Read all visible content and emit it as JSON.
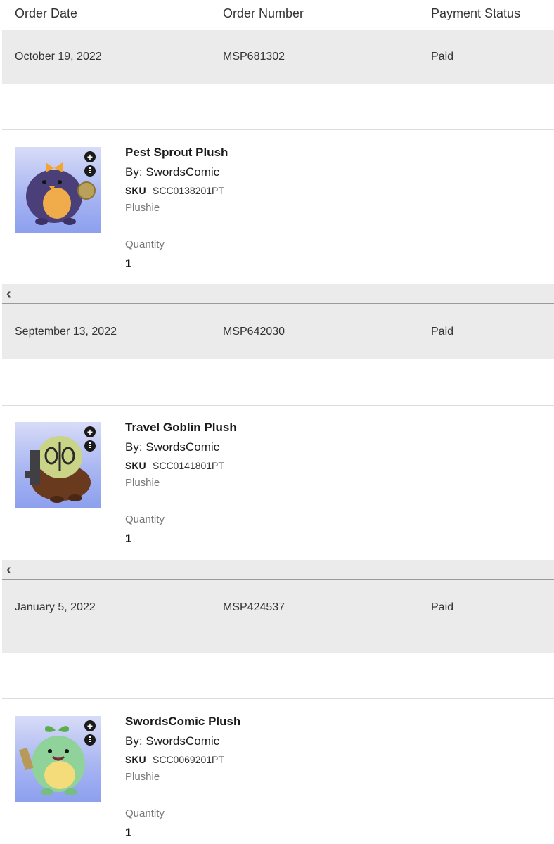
{
  "headers": {
    "order_date": "Order Date",
    "order_number": "Order Number",
    "payment_status": "Payment Status"
  },
  "orders": [
    {
      "date": "October 19, 2022",
      "number": "MSP681302",
      "status": "Paid",
      "item": {
        "title": "Pest Sprout Plush",
        "by": "By: SwordsComic",
        "sku_label": "SKU",
        "sku": "SCC0138201PT",
        "type": "Plushie",
        "qty_label": "Quantity",
        "qty": "1",
        "image_icon": "purple-plush-image"
      }
    },
    {
      "date": "September 13, 2022",
      "number": "MSP642030",
      "status": "Paid",
      "item": {
        "title": "Travel Goblin Plush",
        "by": "By: SwordsComic",
        "sku_label": "SKU",
        "sku": "SCC0141801PT",
        "type": "Plushie",
        "qty_label": "Quantity",
        "qty": "1",
        "image_icon": "goblin-plush-image"
      }
    },
    {
      "date": "January 5, 2022",
      "number": "MSP424537",
      "status": "Paid",
      "item": {
        "title": "SwordsComic Plush",
        "by": "By: SwordsComic",
        "sku_label": "SKU",
        "sku": "SCC0069201PT",
        "type": "Plushie",
        "qty_label": "Quantity",
        "qty": "1",
        "image_icon": "green-plush-image"
      }
    }
  ],
  "controls": {
    "collapse_glyph": "‹",
    "zoom_icon": "plus-circle-icon",
    "info_icon": "info-icon"
  }
}
